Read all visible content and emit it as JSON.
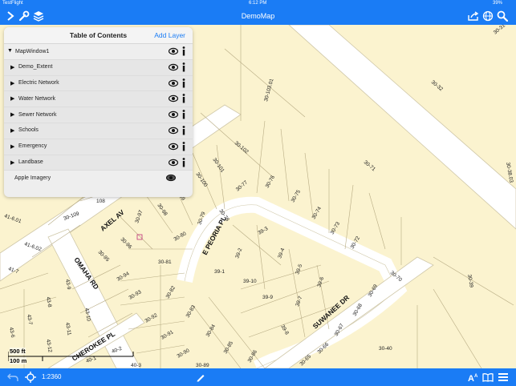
{
  "status_bar": {
    "carrier": "TestFlight",
    "time": "6:12 PM",
    "battery": "39%"
  },
  "app": {
    "title": "DemoMap"
  },
  "toc": {
    "title": "Table of Contents",
    "add_layer": "Add Layer",
    "root": "MapWindow1",
    "layers": [
      {
        "label": "Demo_Extent"
      },
      {
        "label": "Electric Network"
      },
      {
        "label": "Water Network"
      },
      {
        "label": "Sewer Network"
      },
      {
        "label": "Schools"
      },
      {
        "label": "Emergency"
      },
      {
        "label": "Landbase"
      }
    ],
    "basemap": "Apple Imagery"
  },
  "scale_bar": {
    "feet": "500 ft",
    "meters": "100 m"
  },
  "bottom_bar": {
    "scale": "1:2360"
  },
  "map": {
    "streets": [
      "AXEL AV",
      "E PEORIA PL",
      "OMAHA RD",
      "SUWANEE DR",
      "CHEROKEE PL"
    ],
    "parcels": [
      "30-31",
      "30-32",
      "30-103.01",
      "30-71",
      "30-38.03",
      "30-102",
      "30-101",
      "30-100",
      "30-77",
      "30-76",
      "30-75",
      "30-74",
      "30-73",
      "30-72",
      "30-99",
      "30-98",
      "30-79",
      "30-78",
      "30-97",
      "30-96",
      "30-80",
      "30-95",
      "30-94",
      "30-81",
      "30-93",
      "30-82",
      "30-92",
      "30-83",
      "30-91",
      "30-84",
      "30-90",
      "30-85",
      "30-89",
      "30-86",
      "39-3",
      "39-2",
      "39-4",
      "39-1",
      "39-10",
      "39-5",
      "39-6",
      "39-9",
      "39-7",
      "39-8",
      "30-70",
      "30-69",
      "30-68",
      "30-67",
      "30-66",
      "30-65",
      "30-40",
      "30-39",
      "41-6.01",
      "41-6.02",
      "41-7",
      "43-9",
      "43-8",
      "43-10",
      "43-7",
      "43-11",
      "43-6",
      "43-12",
      "40-2",
      "40-1",
      "40-3",
      "30-109",
      "108"
    ]
  },
  "colors": {
    "bar": "#1a7cf5",
    "parcel_fill": "#fbf3cf",
    "road": "#ffffff",
    "accent_link": "#1a7cf5"
  }
}
